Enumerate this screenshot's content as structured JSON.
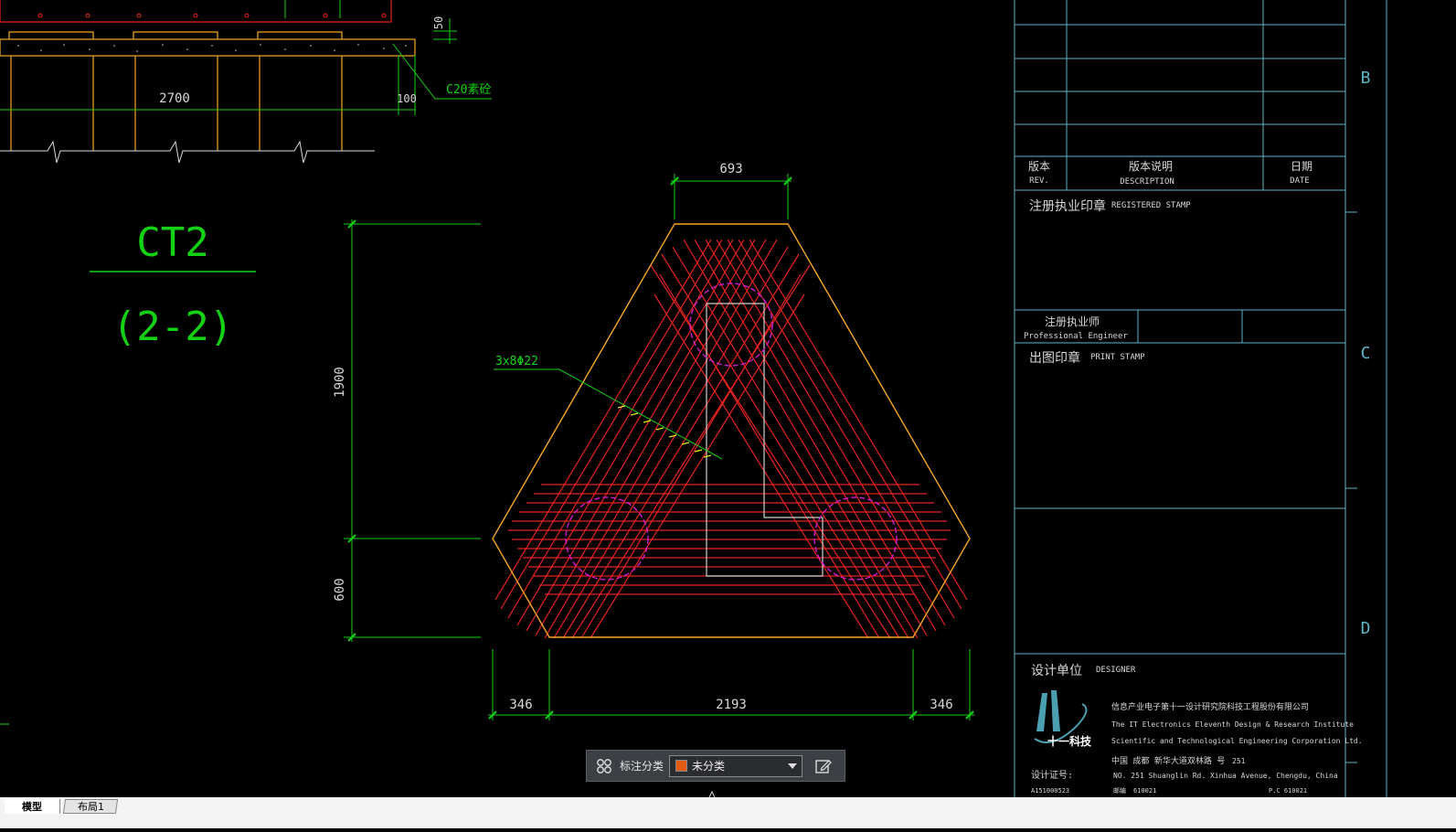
{
  "colors": {
    "background": "#000000",
    "outline": "#f5a623",
    "rebar": "#e8231f",
    "dimension": "#13d213",
    "pile_circle": "#d01bd0",
    "title_block": "#5fb6c8",
    "text_cad": "#d8d8d8"
  },
  "drawing": {
    "top_view": {
      "dim_2700": "2700",
      "dim_100": "100",
      "dim_50": "50",
      "leader_c20": "C20素砼"
    },
    "section_title": {
      "name": "CT2",
      "section": "(2-2)"
    },
    "dimensions": {
      "top_width": "693",
      "height_upper": "1900",
      "height_lower": "600",
      "bottom_left": "346",
      "bottom_middle": "2193",
      "bottom_right": "346"
    },
    "rebar_label": "3x8Φ22"
  },
  "title_block": {
    "rev_label_cn": "版本",
    "rev_label_en": "REV.",
    "desc_label_cn": "版本说明",
    "desc_label_en": "DESCRIPTION",
    "date_label_cn": "日期",
    "date_label_en": "DATE",
    "registered_stamp_cn": "注册执业印章",
    "registered_stamp_en": "REGISTERED STAMP",
    "engineer_cn": "注册执业师",
    "engineer_en": "Professional Engineer",
    "print_stamp_cn": "出图印章",
    "print_stamp_en": "PRINT STAMP",
    "designer_cn": "设计单位",
    "designer_en": "DESIGNER",
    "logo_text": "十一科技",
    "company_cn": "信息产业电子第十一设计研究院科技工程股份有限公司",
    "company_en1": "The IT Electronics Eleventh Design & Research Institute",
    "company_en2": "Scientific and Technological Engineering Corporation Ltd.",
    "address_cn": "中国  成都  新华大道双林路    号",
    "address_no": "251",
    "cert_label": "设计证号:",
    "address_en": "NO. 251 Shuanglin Rd. Xinhua Avenue, Chengdu, China",
    "cert_no": "A151000523",
    "postcode_label": "邮编",
    "postcode": "610021",
    "pc_label": "P.C 610021"
  },
  "border_letters": [
    "B",
    "C",
    "D"
  ],
  "toolbar": {
    "label": "标注分类",
    "selected": "未分类",
    "swatch_color": "#e05a10"
  },
  "tabs": {
    "model": "模型",
    "layout1": "布局1"
  }
}
